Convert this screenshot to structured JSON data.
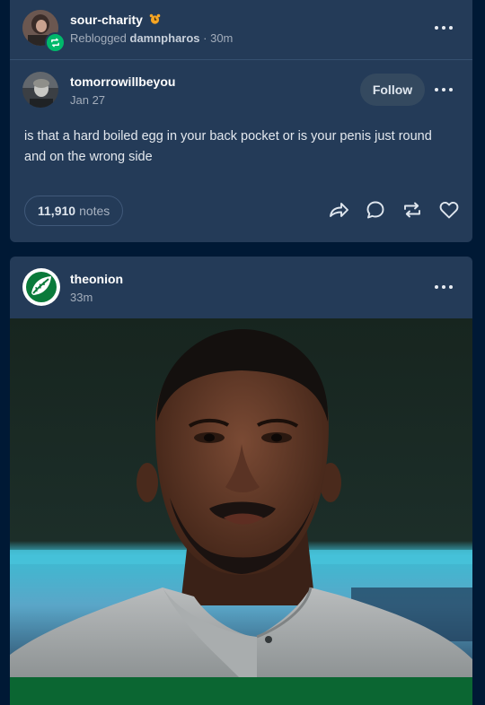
{
  "reblog_header": {
    "username": "sour-charity",
    "badge_icon": "alarm-clock-icon",
    "reblog_prefix": "Reblogged",
    "reblogged_from": "damnpharos",
    "time": "· 30m"
  },
  "original_post": {
    "username": "tomorrowillbeyou",
    "date": "Jan 27",
    "follow_label": "Follow",
    "text": "is that a hard boiled egg in your back pocket or is your penis just round and on the wrong side",
    "notes_count": "11,910",
    "notes_label": "notes",
    "actions": [
      "share-icon",
      "reply-icon",
      "reblog-icon",
      "like-icon"
    ]
  },
  "second_post": {
    "username": "theonion",
    "time": "33m",
    "avatar_icon": "onion-logo-icon"
  },
  "colors": {
    "page_bg": "#001935",
    "card_bg": "#243b58",
    "reblog_badge": "#00b86b",
    "onion_green": "#0b6632"
  }
}
